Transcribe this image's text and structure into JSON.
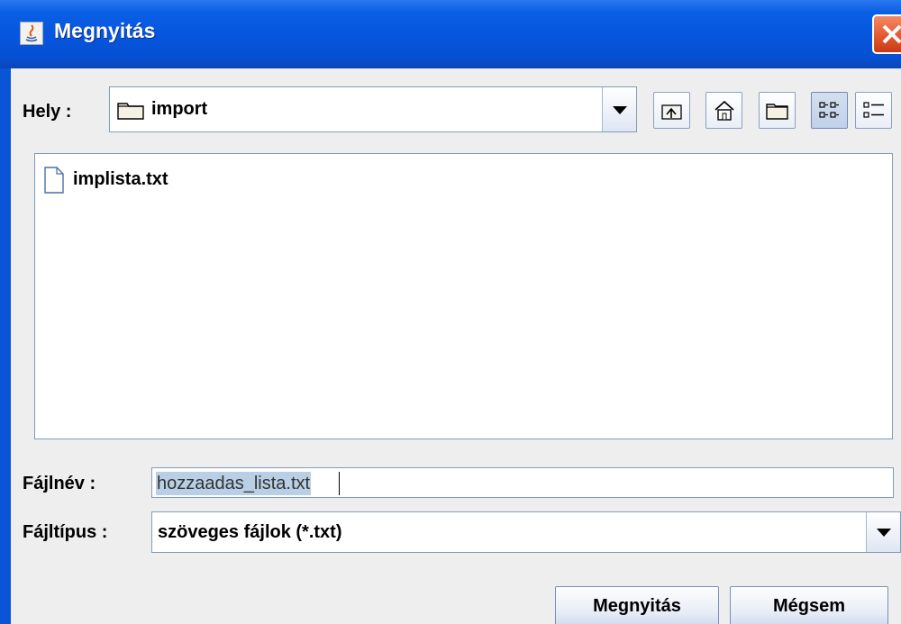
{
  "window": {
    "title": "Megnyitás"
  },
  "location": {
    "label": "Hely :",
    "value": "import"
  },
  "toolbar": {
    "buttons": [
      {
        "name": "up-one-level-icon"
      },
      {
        "name": "home-icon"
      },
      {
        "name": "new-folder-icon"
      },
      {
        "name": "list-view-icon"
      },
      {
        "name": "details-view-icon"
      }
    ]
  },
  "files": [
    {
      "name": "implista.txt",
      "icon": "file-icon"
    }
  ],
  "filename": {
    "label": "Fájlnév :",
    "value": "hozzaadas_lista.txt"
  },
  "filetype": {
    "label": "Fájltípus :",
    "value": "szöveges fájlok (*.txt)"
  },
  "actions": {
    "open_label": "Megnyitás",
    "cancel_label": "Mégsem"
  },
  "colors": {
    "titlebar": "#0656de",
    "panel": "#eeeeee",
    "border": "#7f9db9",
    "selection": "#b8cfe5"
  }
}
